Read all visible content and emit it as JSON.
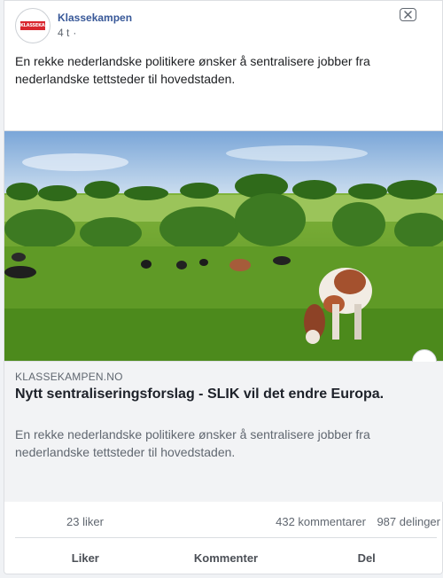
{
  "post": {
    "page_name": "Klassekampen",
    "avatar_text": "KLASSEKAMPEN",
    "time": "4 t",
    "separator": "·",
    "text": "En rekke nederlandske politikere ønsker å sentralisere jobber fra nederlandske tettsteder til hovedstaden."
  },
  "link": {
    "domain": "KLASSEKAMPEN.NO",
    "title": "Nytt sentraliseringsforslag - SLIK vil det endre Europa.",
    "description": "En rekke nederlandske politikere ønsker å sentralisere jobber fra nederlandske tettsteder til hovedstaden."
  },
  "stats": {
    "likes": "23 liker",
    "comments": "432 kommentarer",
    "shares": "987 delinger"
  },
  "actions": {
    "like": "Liker",
    "comment": "Kommenter",
    "share": "Del"
  },
  "icons": {
    "close": "close-icon",
    "globe": "globe-icon"
  },
  "colors": {
    "link_blue": "#385898",
    "brand_red": "#d8262e",
    "muted_text": "#606770"
  }
}
